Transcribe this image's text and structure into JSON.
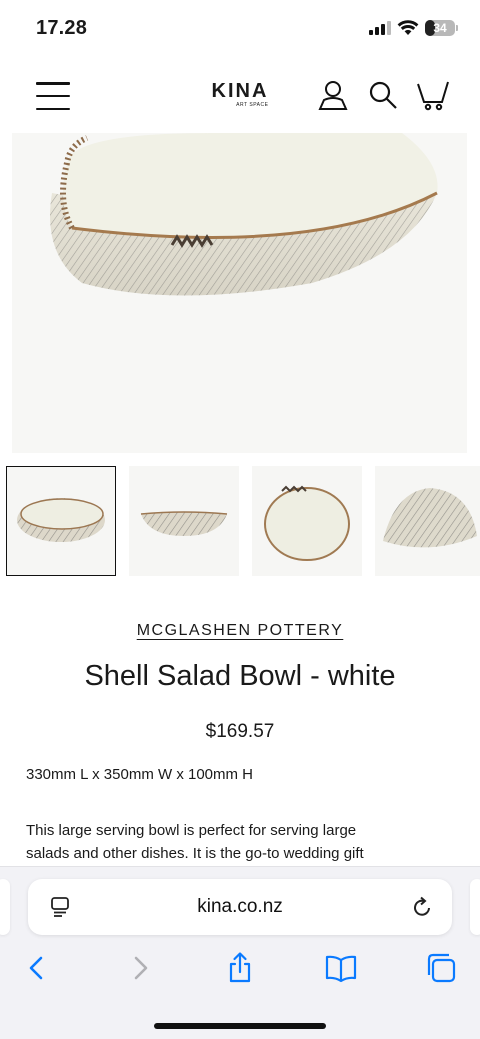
{
  "status_bar": {
    "time": "17.28",
    "battery": "34",
    "battery_level": 0.34
  },
  "header": {
    "logo_main": "KINA",
    "logo_sub": "ART SPACE",
    "icons": [
      "menu-icon",
      "account-icon",
      "search-icon",
      "cart-icon"
    ]
  },
  "gallery": {
    "thumbnail_count": 4,
    "active_index": 0
  },
  "product": {
    "brand": "MCGLASHEN POTTERY",
    "title": "Shell Salad Bowl - white",
    "price": "$169.57",
    "dimensions": "330mm L x 350mm W x 100mm H",
    "description_line1": "This large serving bowl is perfect for serving large",
    "description_line2": "salads and other dishes. It is the go-to wedding gift"
  },
  "browser": {
    "url": "kina.co.nz",
    "icons": [
      "page-menu-icon",
      "reload-icon",
      "back-icon",
      "forward-icon",
      "share-icon",
      "bookmarks-icon",
      "tabs-icon"
    ],
    "accent_color": "#0a7aff",
    "disabled_color": "#b0b0b4"
  }
}
